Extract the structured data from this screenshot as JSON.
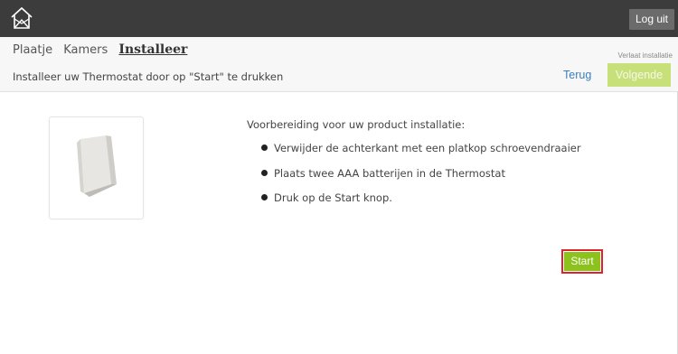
{
  "header": {
    "logo_icon": "house-icon",
    "logout_label": "Log uit"
  },
  "tabs": [
    {
      "label": "Plaatje",
      "active": false
    },
    {
      "label": "Kamers",
      "active": false
    },
    {
      "label": "Installeer",
      "active": true
    }
  ],
  "leave_label": "Verlaat installatie",
  "instruction": "Installeer uw Thermostat door op \"Start\" te drukken",
  "nav": {
    "back_label": "Terug",
    "next_label": "Volgende"
  },
  "product": {
    "image_icon": "thermostat-device-icon"
  },
  "prep_title": "Voorbereiding voor uw product installatie:",
  "steps": [
    "Verwijder de achterkant met een platkop schroevendraaier",
    "Plaats twee AAA batterijen in de Thermostat",
    "Druk op de Start knop."
  ],
  "start_label": "Start",
  "colors": {
    "topbar": "#3c3c3c",
    "next_disabled": "#c8e07a",
    "start_button": "#8cc11e",
    "highlight": "#e0222c",
    "link": "#3a7fbd"
  }
}
